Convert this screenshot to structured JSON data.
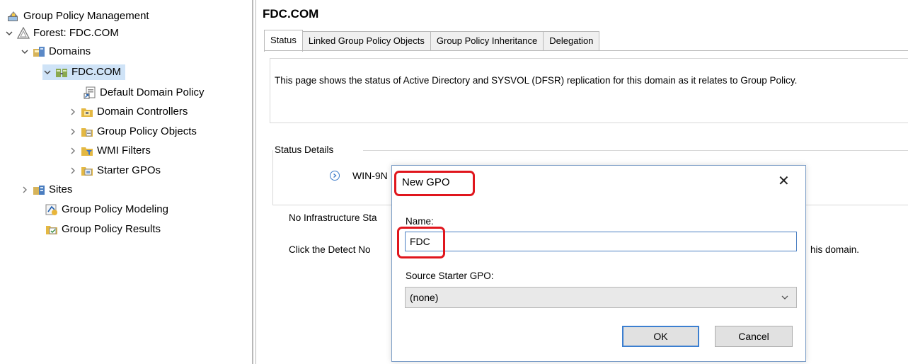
{
  "tree": {
    "root": "Group Policy Management",
    "forest": "Forest: FDC.COM",
    "domains": "Domains",
    "domain": "FDC.COM",
    "items": [
      "Default Domain Policy",
      "Domain Controllers",
      "Group Policy Objects",
      "WMI Filters",
      "Starter GPOs"
    ],
    "sites": "Sites",
    "modeling": "Group Policy Modeling",
    "results": "Group Policy Results"
  },
  "pane": {
    "title": "FDC.COM",
    "tabs": [
      "Status",
      "Linked Group Policy Objects",
      "Group Policy Inheritance",
      "Delegation"
    ],
    "active_tab": "Status",
    "description": "This page shows the status of Active Directory and SYSVOL (DFSR) replication for this domain as it relates to Group Policy.",
    "status_details": "Status Details",
    "dc_name": "WIN-9N",
    "infra_text": "No Infrastructure Sta",
    "detect_text": "Click the Detect No",
    "detect_tail": "his domain."
  },
  "dialog": {
    "title": "New GPO",
    "name_label": "Name:",
    "name_value": "FDC",
    "source_label": "Source Starter GPO:",
    "source_value": "(none)",
    "ok_label": "OK",
    "cancel_label": "Cancel"
  },
  "colors": {
    "highlight": "#e0161d",
    "selection": "#cfe3f7",
    "accent": "#3c7fd0"
  }
}
